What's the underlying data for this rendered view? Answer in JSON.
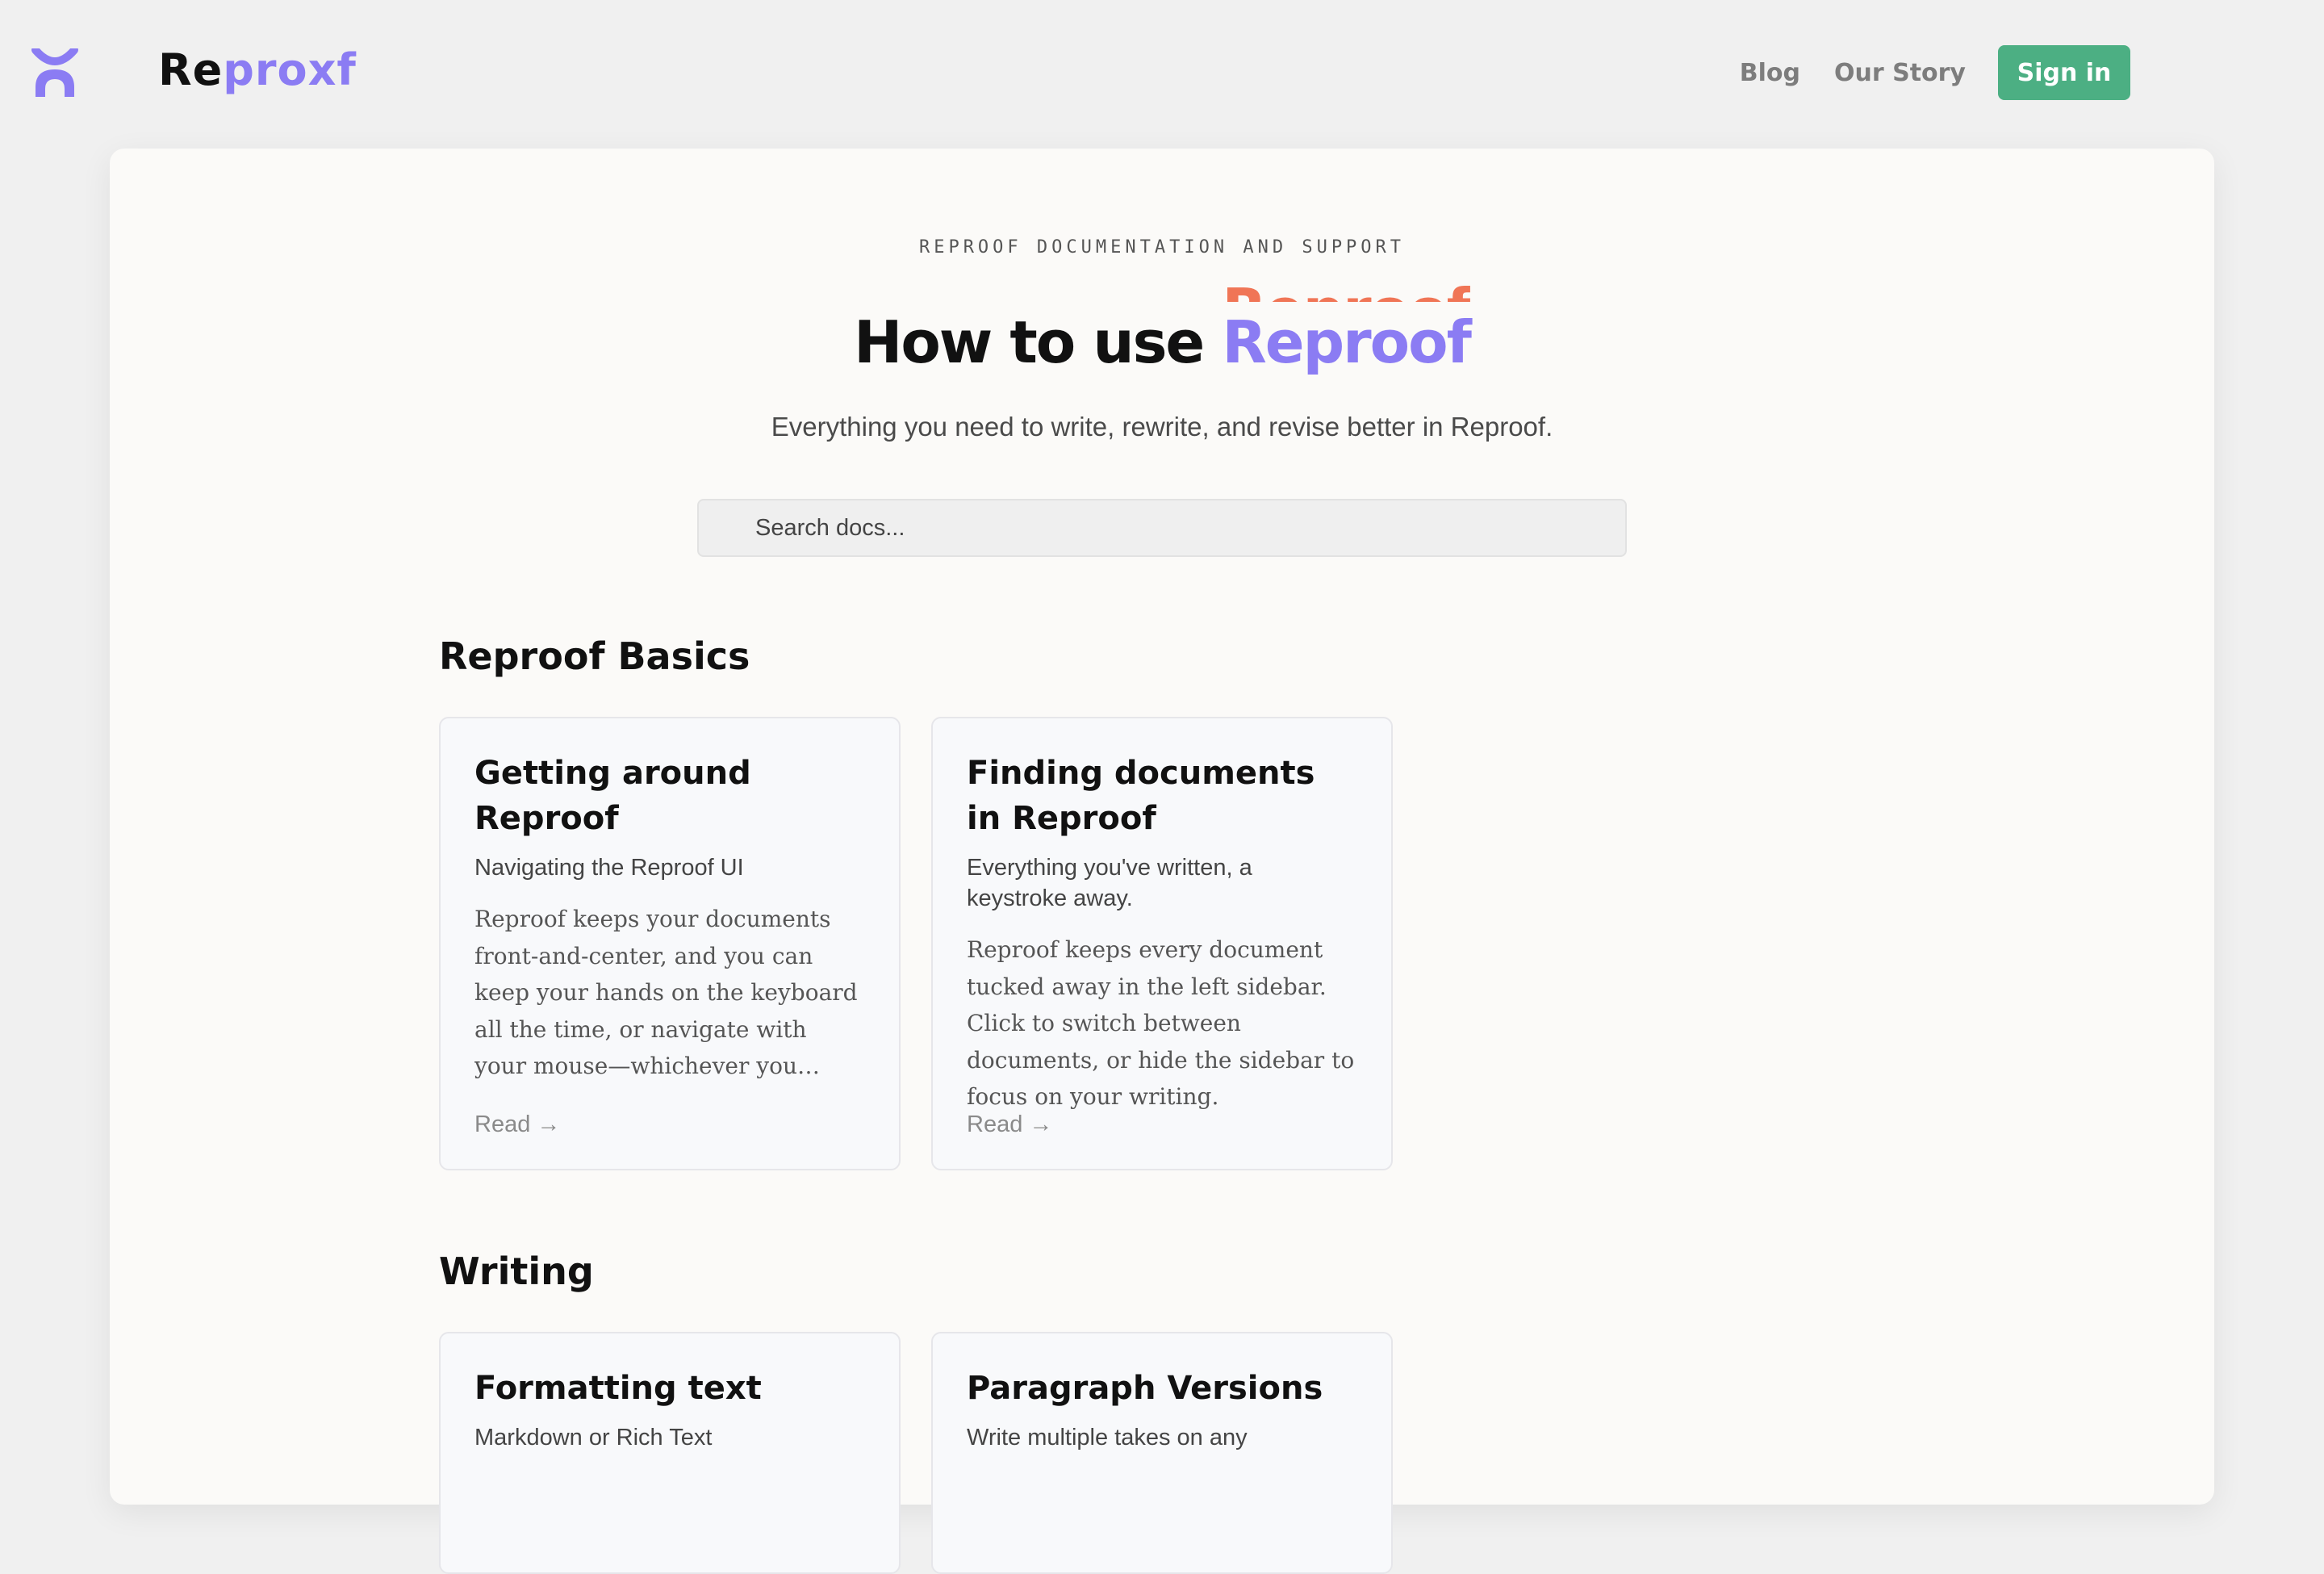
{
  "brand": {
    "wordmark_a": "Re",
    "wordmark_b": "proxf",
    "icon": "reproof-logo-icon"
  },
  "nav": {
    "blog": "Blog",
    "story": "Our Story",
    "signin": "Sign in"
  },
  "hero": {
    "eyebrow": "REPROOF DOCUMENTATION AND SUPPORT",
    "title_prefix": "How to use",
    "title_brand": "Reproof",
    "subtitle": "Everything you need to write, rewrite, and revise better in Reproof."
  },
  "search": {
    "placeholder": "Search docs..."
  },
  "sections": [
    {
      "title": "Reproof Basics",
      "cards": [
        {
          "title": "Getting around Reproof",
          "subtitle": "Navigating the Reproof UI",
          "body": "Reproof keeps your documents front-and-center, and you can keep your hands on the keyboard all the time, or navigate with your mouse—whichever you prefer.",
          "cta": "Read →"
        },
        {
          "title": "Finding documents in Reproof",
          "subtitle": "Everything you've written, a keystroke away.",
          "body": "Reproof keeps every document tucked away in the left sidebar. Click to switch between documents, or hide the sidebar to focus on your writing.",
          "cta": "Read →"
        }
      ]
    },
    {
      "title": "Writing",
      "cards": [
        {
          "title": "Formatting text",
          "subtitle": "Markdown or Rich Text"
        },
        {
          "title": "Paragraph Versions",
          "subtitle": "Write multiple takes on any"
        }
      ]
    }
  ],
  "colors": {
    "accent": "#8b7cf3",
    "accent_secondary": "#f07556",
    "signin": "#4caf83"
  }
}
